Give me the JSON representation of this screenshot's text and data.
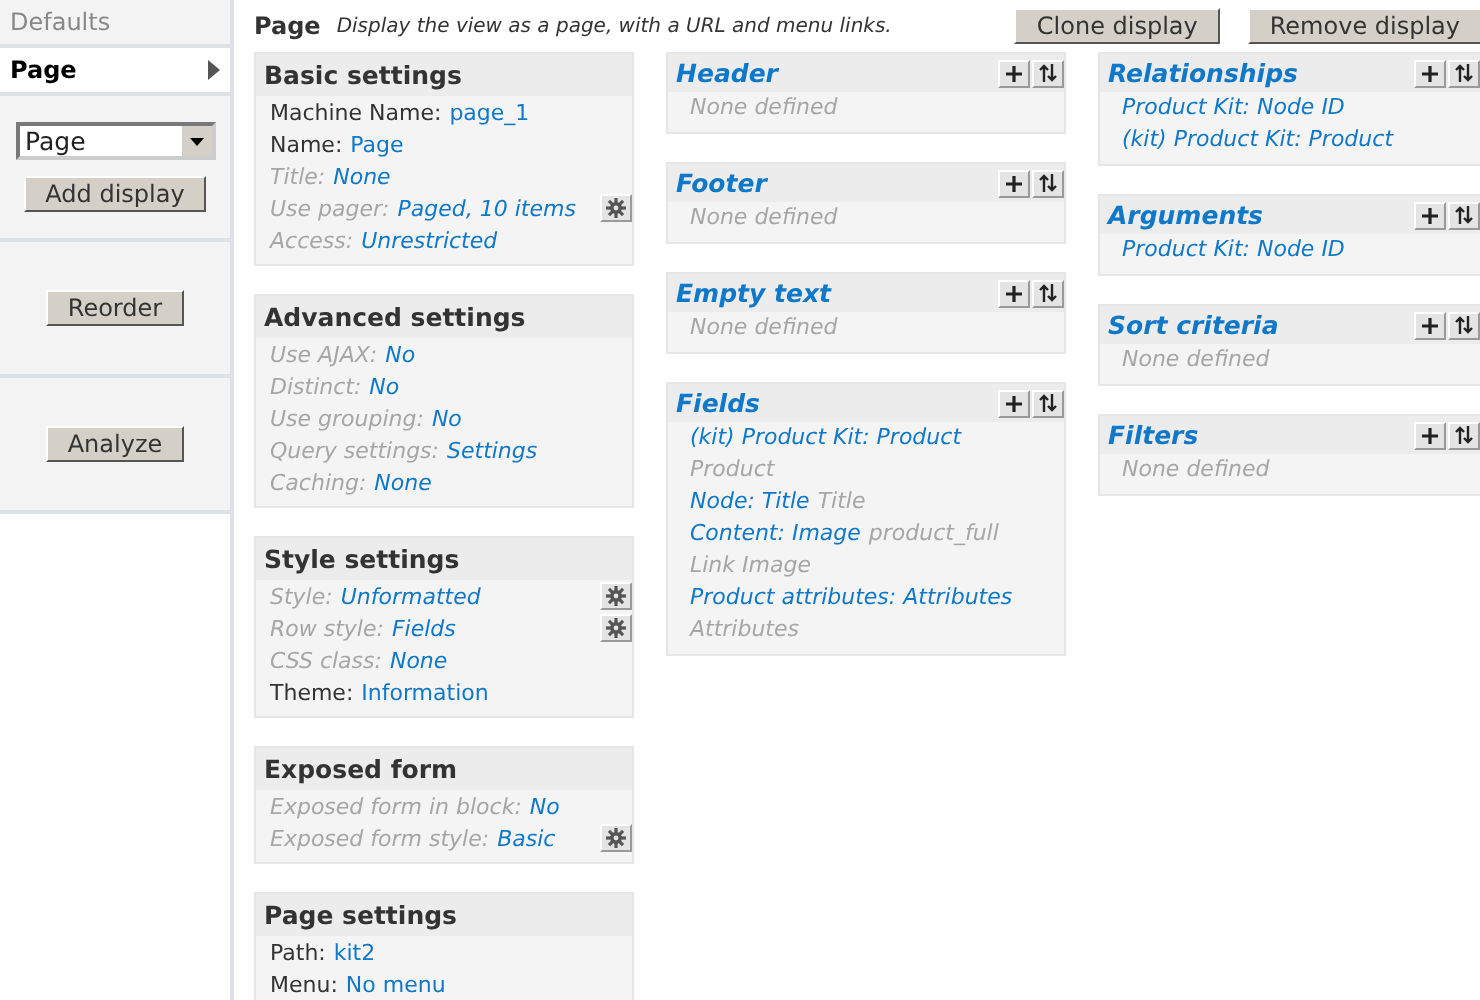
{
  "sidebar": {
    "tabs": [
      {
        "label": "Defaults",
        "selected": false
      },
      {
        "label": "Page",
        "selected": true
      }
    ],
    "display_select": {
      "value": "Page"
    },
    "add_button": "Add display",
    "reorder_button": "Reorder",
    "analyze_button": "Analyze"
  },
  "header": {
    "title": "Page",
    "description": "Display the view as a page, with a URL and menu links.",
    "buttons": [
      "Clone display",
      "Remove display"
    ]
  },
  "settings": [
    {
      "title": "Basic settings",
      "rows": [
        {
          "label": "Machine Name:",
          "value": "page_1",
          "kind": "overridden",
          "gear": false
        },
        {
          "label": "Name:",
          "value": "Page",
          "kind": "overridden",
          "gear": false
        },
        {
          "label": "Title:",
          "value": "None",
          "kind": "default",
          "gear": false
        },
        {
          "label": "Use pager:",
          "value": "Paged, 10 items",
          "kind": "default",
          "gear": true
        },
        {
          "label": "Access:",
          "value": "Unrestricted",
          "kind": "default",
          "gear": false
        }
      ]
    },
    {
      "title": "Advanced settings",
      "rows": [
        {
          "label": "Use AJAX:",
          "value": "No",
          "kind": "default",
          "gear": false
        },
        {
          "label": "Distinct:",
          "value": "No",
          "kind": "default",
          "gear": false
        },
        {
          "label": "Use grouping:",
          "value": "No",
          "kind": "default",
          "gear": false
        },
        {
          "label": "Query settings:",
          "value": "Settings",
          "kind": "default",
          "gear": false
        },
        {
          "label": "Caching:",
          "value": "None",
          "kind": "default",
          "gear": false
        }
      ]
    },
    {
      "title": "Style settings",
      "rows": [
        {
          "label": "Style:",
          "value": "Unformatted",
          "kind": "default",
          "gear": true
        },
        {
          "label": "Row style:",
          "value": "Fields",
          "kind": "default",
          "gear": true
        },
        {
          "label": "CSS class:",
          "value": "None",
          "kind": "default",
          "gear": false
        },
        {
          "label": "Theme:",
          "value": "Information",
          "kind": "overridden",
          "gear": false
        }
      ]
    },
    {
      "title": "Exposed form",
      "rows": [
        {
          "label": "Exposed form in block:",
          "value": "No",
          "kind": "default",
          "gear": false
        },
        {
          "label": "Exposed form style:",
          "value": "Basic",
          "kind": "default",
          "gear": true
        }
      ]
    },
    {
      "title": "Page settings",
      "rows": [
        {
          "label": "Path:",
          "value": "kit2",
          "kind": "overridden",
          "gear": false
        },
        {
          "label": "Menu:",
          "value": "No menu",
          "kind": "overridden",
          "gear": false
        }
      ]
    }
  ],
  "handler_columns": [
    [
      {
        "title": "Header",
        "lines": [
          [
            {
              "text": "None defined",
              "kind": "empty"
            }
          ]
        ]
      },
      {
        "title": "Footer",
        "lines": [
          [
            {
              "text": "None defined",
              "kind": "empty"
            }
          ]
        ]
      },
      {
        "title": "Empty text",
        "lines": [
          [
            {
              "text": "None defined",
              "kind": "empty"
            }
          ]
        ]
      },
      {
        "title": "Fields",
        "lines": [
          [
            {
              "text": "(kit) Product Kit: Product",
              "kind": "link"
            }
          ],
          [
            {
              "text": "Product",
              "kind": "empty"
            }
          ],
          [
            {
              "text": "Node: Title",
              "kind": "link"
            },
            {
              "text": "Title",
              "kind": "empty"
            }
          ],
          [
            {
              "text": "Content: Image",
              "kind": "link"
            },
            {
              "text": "product_full",
              "kind": "empty"
            }
          ],
          [
            {
              "text": "Link Image",
              "kind": "empty"
            }
          ],
          [
            {
              "text": "Product attributes: Attributes",
              "kind": "link"
            }
          ],
          [
            {
              "text": "Attributes",
              "kind": "empty"
            }
          ]
        ]
      }
    ],
    [
      {
        "title": "Relationships",
        "lines": [
          [
            {
              "text": "Product Kit: Node ID",
              "kind": "link"
            }
          ],
          [
            {
              "text": "(kit) Product Kit: Product",
              "kind": "link"
            }
          ]
        ]
      },
      {
        "title": "Arguments",
        "lines": [
          [
            {
              "text": "Product Kit: Node ID",
              "kind": "link"
            }
          ]
        ]
      },
      {
        "title": "Sort criteria",
        "lines": [
          [
            {
              "text": "None defined",
              "kind": "empty"
            }
          ]
        ]
      },
      {
        "title": "Filters",
        "lines": [
          [
            {
              "text": "None defined",
              "kind": "empty"
            }
          ]
        ]
      }
    ]
  ]
}
